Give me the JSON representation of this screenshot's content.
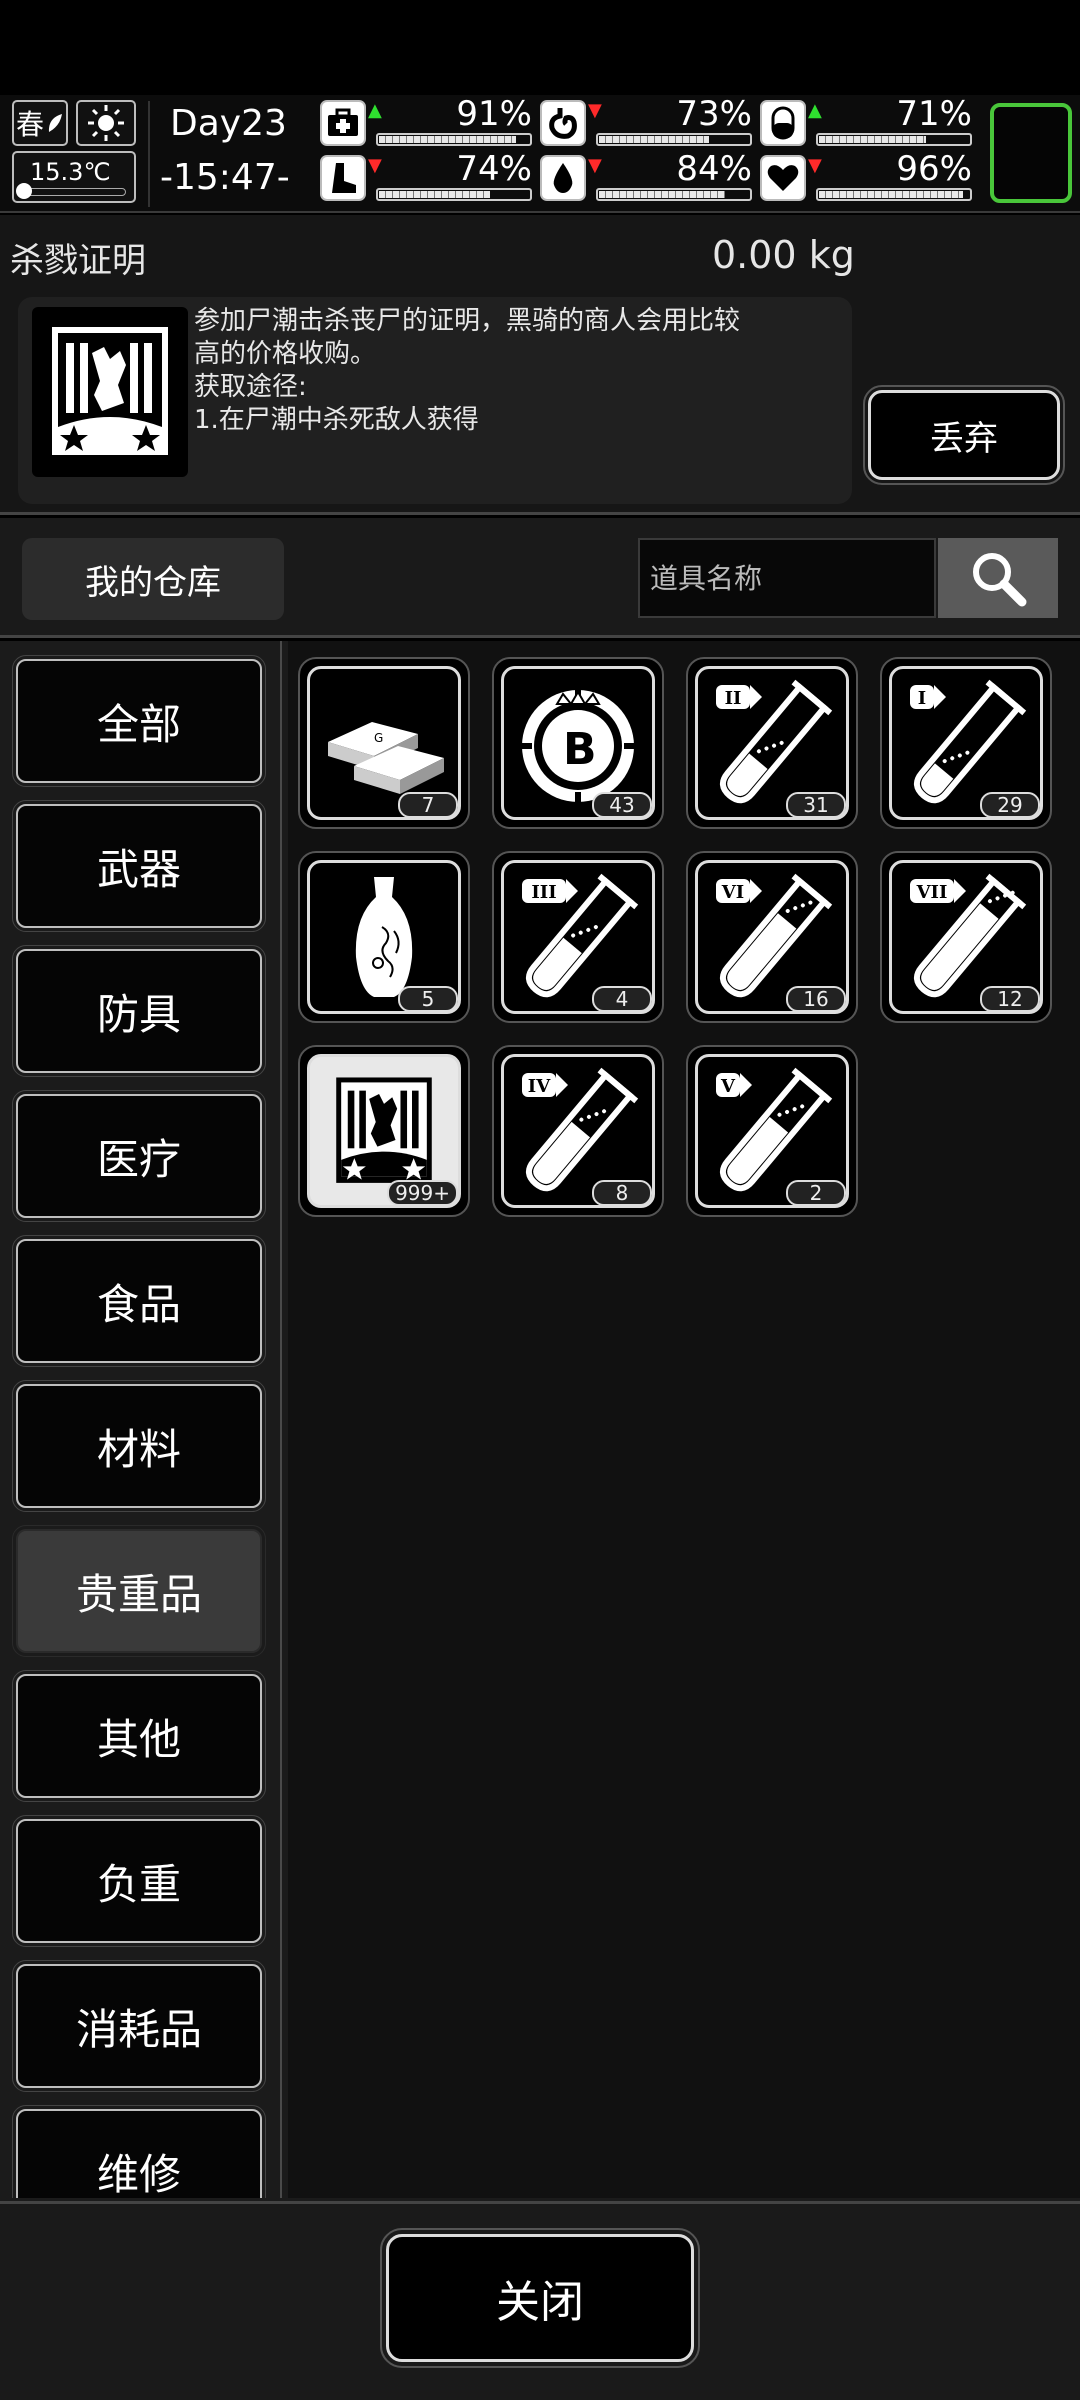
{
  "status": {
    "season": "春",
    "temperature": "15.3℃",
    "day": "Day23",
    "time": "-15:47-",
    "stats": [
      {
        "name": "health",
        "icon": "medkit-icon",
        "trend": "up",
        "percent": "91%",
        "level": 0.91
      },
      {
        "name": "hunger",
        "icon": "stomach-icon",
        "trend": "down",
        "percent": "73%",
        "level": 0.73
      },
      {
        "name": "medicine",
        "icon": "pill-icon",
        "trend": "up",
        "percent": "71%",
        "level": 0.71
      },
      {
        "name": "stamina",
        "icon": "foot-icon",
        "trend": "down",
        "percent": "74%",
        "level": 0.74
      },
      {
        "name": "thirst",
        "icon": "water-drop-icon",
        "trend": "down",
        "percent": "84%",
        "level": 0.84
      },
      {
        "name": "mood",
        "icon": "heart-icon",
        "trend": "down",
        "percent": "96%",
        "level": 0.96
      }
    ],
    "accent_color": "#49c63a"
  },
  "selected_item": {
    "name": "杀戮证明",
    "weight": "0.00 kg",
    "description": [
      "参加尸潮击杀丧尸的证明，黑骑的商人会用比较",
      "高的价格收购。",
      "获取途径:",
      "1.在尸潮中杀死敌人获得"
    ],
    "discard_label": "丢弃"
  },
  "warehouse": {
    "title": "我的仓库",
    "search_placeholder": "道具名称"
  },
  "categories": [
    "全部",
    "武器",
    "防具",
    "医疗",
    "食品",
    "材料",
    "贵重品",
    "其他",
    "负重",
    "消耗品",
    "维修"
  ],
  "active_category": "贵重品",
  "items": [
    {
      "name": "gold-bar",
      "icon": "gold-bar-icon",
      "count": "7"
    },
    {
      "name": "b-coin",
      "icon": "coin-icon",
      "count": "43"
    },
    {
      "name": "potion-ii",
      "icon": "test-tube-icon",
      "grade": "II",
      "fill": 0.35,
      "count": "31"
    },
    {
      "name": "potion-i",
      "icon": "test-tube-icon",
      "grade": "I",
      "fill": 0.25,
      "count": "29"
    },
    {
      "name": "vase",
      "icon": "vase-icon",
      "count": "5"
    },
    {
      "name": "potion-iii",
      "icon": "test-tube-icon",
      "grade": "III",
      "fill": 0.45,
      "count": "4"
    },
    {
      "name": "potion-vi",
      "icon": "test-tube-icon",
      "grade": "VI",
      "fill": 0.7,
      "count": "16"
    },
    {
      "name": "potion-vii",
      "icon": "test-tube-icon",
      "grade": "VII",
      "fill": 0.8,
      "count": "12"
    },
    {
      "name": "kill-proof",
      "icon": "kill-proof-icon",
      "count": "999+",
      "selected": true
    },
    {
      "name": "potion-iv",
      "icon": "test-tube-icon",
      "grade": "IV",
      "fill": 0.55,
      "count": "8"
    },
    {
      "name": "potion-v",
      "icon": "test-tube-icon",
      "grade": "V",
      "fill": 0.6,
      "count": "2"
    }
  ],
  "close_label": "关闭"
}
